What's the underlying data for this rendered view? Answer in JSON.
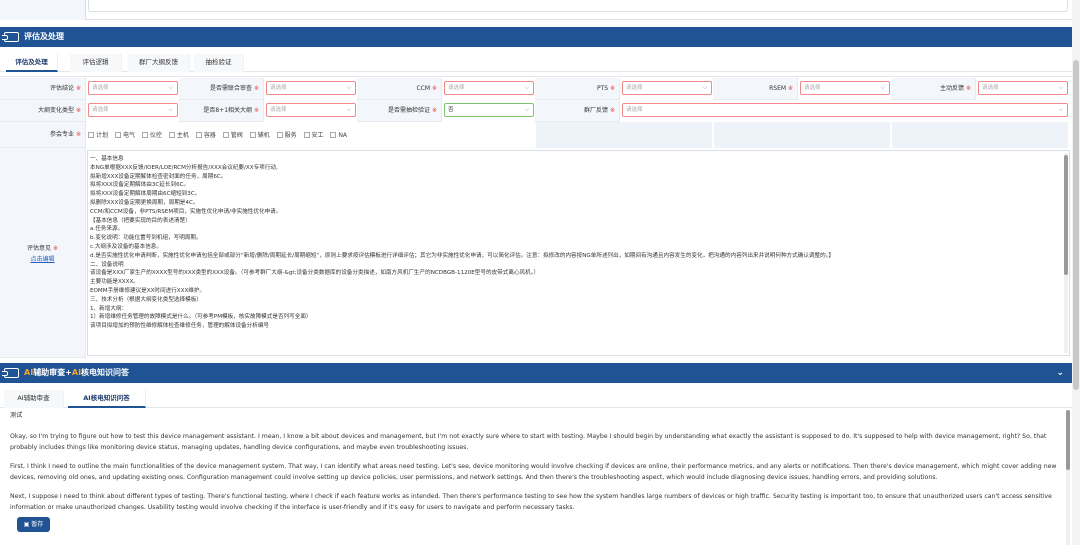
{
  "section_eval": {
    "title": "评估及处理",
    "tabs": [
      "评估及处理",
      "评估逻辑",
      "群厂大纲反馈",
      "抽检验证"
    ]
  },
  "form": {
    "row1": [
      {
        "label": "评估结论",
        "value": "请选择"
      },
      {
        "label": "是否需联合审查",
        "value": "请选择"
      },
      {
        "label": "CCM",
        "value": "请选择"
      },
      {
        "label": "PTS",
        "value": "请选择"
      },
      {
        "label": "RSEM",
        "value": "请选择"
      },
      {
        "label": "主动反馈",
        "value": "请选择"
      }
    ],
    "row2": [
      {
        "label": "大纲变化类型",
        "value": "请选择"
      },
      {
        "label": "是否8+1相关大纲",
        "value": "请选择"
      },
      {
        "label": "是否需抽检验证",
        "value": "否"
      },
      {
        "label": "群厂反馈",
        "value": "请选择"
      }
    ],
    "row3_label": "参会专业",
    "checkboxes": [
      "计划",
      "电气",
      "仪控",
      "主机",
      "容器",
      "管阀",
      "辅机",
      "服务",
      "安工",
      "NA"
    ],
    "opinion_label": "评估意见",
    "opinion_link": "点击编辑",
    "opinion_lines": [
      "一、基本信息",
      "本NG单根据XXX反馈/IOER/LOE/RCM分析报告/XXX会议纪要/XX专项行动,",
      "拟新增XXX设备定期解体检查密封面的任务，周期6C。",
      "拟将XXX设备定期解体由3C延长到6C。",
      "拟将XXX设备定期解体周期由6C缩短到3C。",
      "拟删除XXX设备定期更换周期，周期是4C。",
      "CCM/和CCM设备，非PTS/RSEM项目，实施性优化申请/非实施性优化申请。",
      "【基本信息（把要实现的目的表述清楚）",
      "a.任务来源。",
      "b.变化说明：功能位置号到机组，写明周期。",
      "c.大纲涉及设备的基本信息。",
      "d.是否实施性优化申请判断，实施性优化申请包括全部或部分“新增/删除/周期延长/周期缩短”，原则上要求按评估模板进行详细评估；其它为非实施性优化申请，可以简化评估。注意：拟修改的内容按NG单所述列出，如期间有沟通且内容发生的变化，把沟通的内容列出来并说明何种方式确认调整的。】",
      "二、设备说明",
      "该设备是XXX厂家生产的XXXX型号的XXX类型的XXX设备。（可参考群厂大纲-&gt;设备分类数据库的设备分类描述，如南方风机厂生产的NCDBGB-1120E型号的皮带式离心风机。）",
      "主要功能是XXXX。",
      "EOMM手册维修建议是XX时间进行XXX维护。",
      "三、技术分析（根据大纲变化类型选择模板）",
      "1、新增大纲：",
      "1）新增维修任务管理的故障模式是什么。（可参考PM模板，核实故障模式是否列写全面）",
      "该项目拟增加的预防性维修解体检查维修任务，管理的解体设备分析编号"
    ]
  },
  "section_ai": {
    "title_parts": [
      "AI",
      "辅助审查+",
      "AI",
      "核电知识问答"
    ],
    "tabs": [
      "AI辅助审查",
      "AI核电知识问答"
    ],
    "paragraphs": [
      "测试",
      "Okay, so I'm trying to figure out how to test this device management assistant. I mean, I know a bit about devices and management, but I'm not exactly sure where to start with testing. Maybe I should begin by understanding what exactly the assistant is supposed to do. It's supposed to help with device management, right? So, that probably includes things like monitoring device status, managing updates, handling device configurations, and maybe even troubleshooting issues.",
      "First, I think I need to outline the main functionalities of the device management system. That way, I can identify what areas need testing. Let's see, device monitoring would involve checking if devices are online, their performance metrics, and any alerts or notifications. Then there's device management, which might cover adding new devices, removing old ones, and updating existing ones. Configuration management could involve setting up device policies, user permissions, and network settings. And then there's the troubleshooting aspect, which would include diagnosing device issues, handling errors, and providing solutions.",
      "Next, I suppose I need to think about different types of testing. There's functional testing, where I check if each feature works as intended. Then there's performance testing to see how the system handles large numbers of devices or high traffic. Security testing is important too, to ensure that unauthorized users can't access sensitive information or make unauthorized changes. Usability testing would involve checking if the interface is user-friendly and if it's easy for users to navigate and perform necessary tasks."
    ]
  },
  "draft_button": "暂存",
  "colors": {
    "header": "#1f5394",
    "accent": "#f5a623",
    "required": "#e04040",
    "invalid_border": "#f08a8a",
    "valid_border": "#7cc46b"
  }
}
